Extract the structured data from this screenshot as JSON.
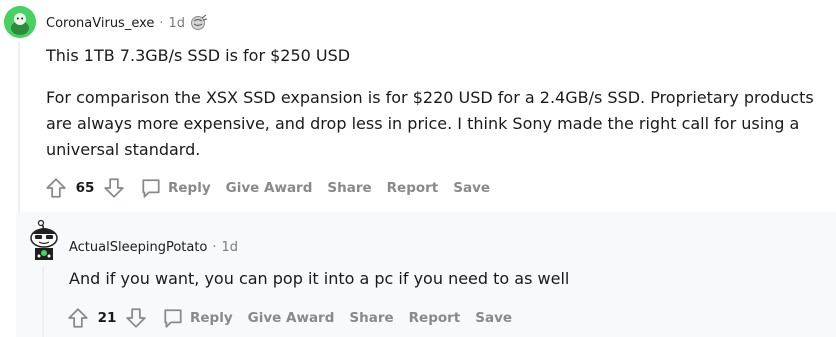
{
  "colors": {
    "upvote_gray": "#878a8c",
    "thread_line": "#edeff1",
    "reply_bg": "#f8f9fa"
  },
  "comments": [
    {
      "author": "CoronaVirus_exe",
      "separator": "·",
      "time": "1d",
      "paragraphs": [
        "This 1TB 7.3GB/s SSD is for $250 USD",
        "For comparison the XSX SSD expansion is for $220 USD for a 2.4GB/s SSD. Proprietary products are always more expensive, and drop less in price. I think Sony made the right call for using a universal standard."
      ],
      "score": "65",
      "actions": {
        "reply": "Reply",
        "give_award": "Give Award",
        "share": "Share",
        "report": "Report",
        "save": "Save"
      }
    },
    {
      "author": "ActualSleepingPotato",
      "separator": "·",
      "time": "1d",
      "paragraphs": [
        "And if you want, you can pop it into a pc if you need to as well"
      ],
      "score": "21",
      "actions": {
        "reply": "Reply",
        "give_award": "Give Award",
        "share": "Share",
        "report": "Report",
        "save": "Save"
      }
    }
  ]
}
